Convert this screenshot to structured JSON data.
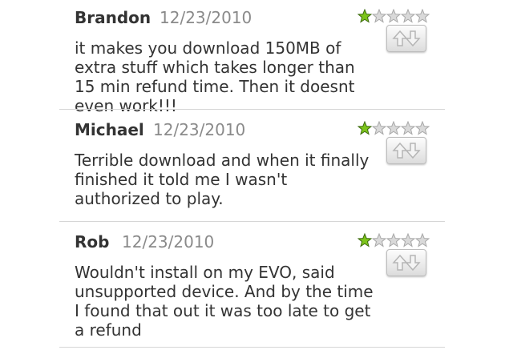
{
  "reviews": [
    {
      "author": "Brandon",
      "date": "12/23/2010",
      "rating": 1,
      "rating_max": 5,
      "text": "it makes you download 150MB of extra stuff which takes longer than 15 min refund time. Then it doesnt even work!!!"
    },
    {
      "author": "Michael",
      "date": "12/23/2010",
      "rating": 1,
      "rating_max": 5,
      "text": "Terrible download and when it finally finished it told me I wasn't authorized to play."
    },
    {
      "author": "Rob",
      "date": "12/23/2010",
      "rating": 1,
      "rating_max": 5,
      "text": "Wouldn't install on my EVO, said unsupported device. And by the time I found that out it was too late to get a refund"
    }
  ],
  "icons": {
    "star_filled": "star-filled-icon",
    "star_empty": "star-empty-icon",
    "vote": "up-down-arrows-icon"
  },
  "colors": {
    "star_filled": "#7cc41a",
    "star_empty": "#d9d9d9",
    "author": "#333333",
    "date": "#8a8a8a",
    "divider": "#d6d6d6"
  }
}
